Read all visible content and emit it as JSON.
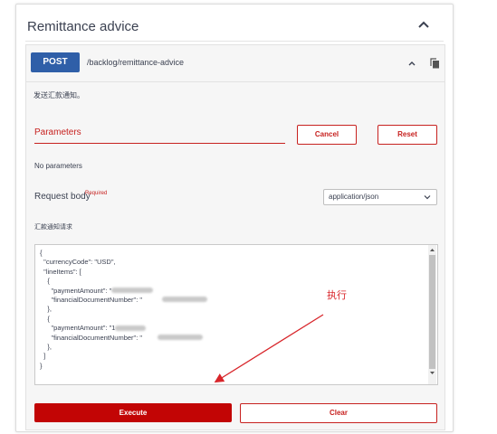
{
  "section": {
    "title": "Remittance advice"
  },
  "operation": {
    "method": "POST",
    "path": "/backlog/remittance-advice",
    "description": "发送汇款通知。"
  },
  "parameters": {
    "tab_label": "Parameters",
    "cancel_label": "Cancel",
    "reset_label": "Reset",
    "empty_text": "No parameters"
  },
  "request_body": {
    "label": "Request body",
    "required_label": "Required",
    "content_type": "application/json",
    "description": "汇款通知请求",
    "example_lines": [
      "{",
      "  \"currencyCode\": \"USD\",",
      "  \"lineItems\": [",
      "    {",
      "      \"paymentAmount\": \"",
      "      \"financialDocumentNumber\": \"",
      "    },",
      "    {",
      "      \"paymentAmount\": \"1",
      "      \"financialDocumentNumber\": \"",
      "    },",
      "  ]",
      "}"
    ]
  },
  "annotation": {
    "text": "执行",
    "color": "#d8252a"
  },
  "actions": {
    "execute_label": "Execute",
    "clear_label": "Clear"
  },
  "colors": {
    "accent": "#c7211f",
    "execute_bg": "#c20505",
    "method_bg": "#2f5fa8"
  }
}
